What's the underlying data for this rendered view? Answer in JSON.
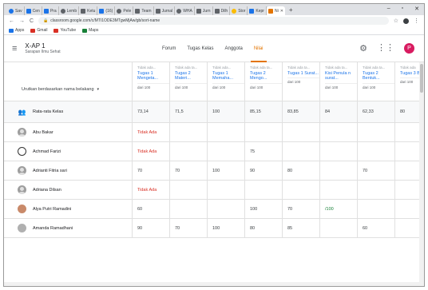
{
  "browser": {
    "tabs": [
      {
        "label": "Sav",
        "color": "#1a73e8"
      },
      {
        "label": "Cen",
        "color": "#1a73e8"
      },
      {
        "label": "Pra",
        "color": "#1a73e8"
      },
      {
        "label": "Lemb",
        "color": "#5f6368"
      },
      {
        "label": "Ketu",
        "color": "#5f6368"
      },
      {
        "label": "(16)",
        "color": "#1a73e8"
      },
      {
        "label": "Pele",
        "color": "#5f6368"
      },
      {
        "label": "Team",
        "color": "#5f6368"
      },
      {
        "label": "Jurnal",
        "color": "#5f6368"
      },
      {
        "label": "WHA",
        "color": "#5f6368"
      },
      {
        "label": "Jurn",
        "color": "#5f6368"
      },
      {
        "label": "Dilh",
        "color": "#5f6368"
      },
      {
        "label": "Stor",
        "color": "#fbbc04"
      },
      {
        "label": "Kepr",
        "color": "#1a73e8"
      },
      {
        "label": "Ni",
        "color": "#e37400",
        "active": true
      }
    ],
    "new_tab": "+",
    "url": "classroom.google.com/c/MTI1ODE3MTgwMjAw/gb/sort-name",
    "bookmarks": [
      {
        "label": "Apps",
        "color": "#1a73e8"
      },
      {
        "label": "Gmail",
        "color": "#d93025"
      },
      {
        "label": "YouTube",
        "color": "#d93025"
      },
      {
        "label": "Maps",
        "color": "#188038"
      }
    ]
  },
  "classroom": {
    "class_name": "X-AP 1",
    "class_subtitle": "Sarapan Ilmu Sehat",
    "nav": [
      {
        "label": "Forum",
        "active": false
      },
      {
        "label": "Tugas Kelas",
        "active": false
      },
      {
        "label": "Anggota",
        "active": false
      },
      {
        "label": "Nilai",
        "active": true
      }
    ],
    "avatar_letter": "P",
    "accent_color": "#e37400"
  },
  "grid": {
    "sort_label": "Urutkan berdasarkan nama belakang",
    "assignments": [
      {
        "date": "Tidak ada...",
        "title": "Tugas 1 Mengeta...",
        "points": "dari 100"
      },
      {
        "date": "Tidak ada ta...",
        "title": "Tugas 2 Materi...",
        "points": "dari 100"
      },
      {
        "date": "Tidak ada...",
        "title": "Tugas 1 Memaha...",
        "points": "dari 100"
      },
      {
        "date": "Tidak ada ta...",
        "title": "Tugas 2 Mengo...",
        "points": "dari 100"
      },
      {
        "date": "Tidak ada ta...",
        "title": "Tugas 1 Surat...",
        "points": "dari 100"
      },
      {
        "date": "Tidak ada ta...",
        "title": "Kisi Penula n surat...",
        "points": "dari 100"
      },
      {
        "date": "Tidak ada ta...",
        "title": "Tugas 2 Bentuk...",
        "points": "dari 100"
      },
      {
        "date": "Tidak ada",
        "title": "Tugas 3 Bentuk",
        "points": "dari 100"
      }
    ],
    "average_row": {
      "label": "Rata-rata Kelas",
      "values": [
        "73,14",
        "71,5",
        "100",
        "85,15",
        "83,85",
        "84",
        "62,33",
        "80"
      ]
    },
    "students": [
      {
        "name": "Abu Bakar",
        "avatar": "generic",
        "grades": [
          "Tidak Ada",
          "",
          "",
          "",
          "",
          "",
          "",
          ""
        ]
      },
      {
        "name": "Achmad Farizi",
        "avatar": "cartoon",
        "grades": [
          "Tidak Ada",
          "",
          "",
          "75",
          "",
          "",
          "",
          ""
        ]
      },
      {
        "name": "Adrianti Fitria sari",
        "avatar": "generic",
        "grades": [
          "70",
          "70",
          "100",
          "90",
          "80",
          "",
          "70",
          ""
        ]
      },
      {
        "name": "Adriana Dilsan",
        "avatar": "generic",
        "grades": [
          "Tidak Ada",
          "",
          "",
          "",
          "",
          "",
          "",
          ""
        ]
      },
      {
        "name": "Alya Putri Ramadini",
        "avatar": "photo1",
        "grades": [
          "60",
          "",
          "",
          "100",
          "70",
          "/100",
          "",
          ""
        ]
      },
      {
        "name": "Amanda Ramadhani",
        "avatar": "photo2",
        "grades": [
          "90",
          "70",
          "100",
          "80",
          "85",
          "",
          "60",
          ""
        ]
      }
    ]
  }
}
